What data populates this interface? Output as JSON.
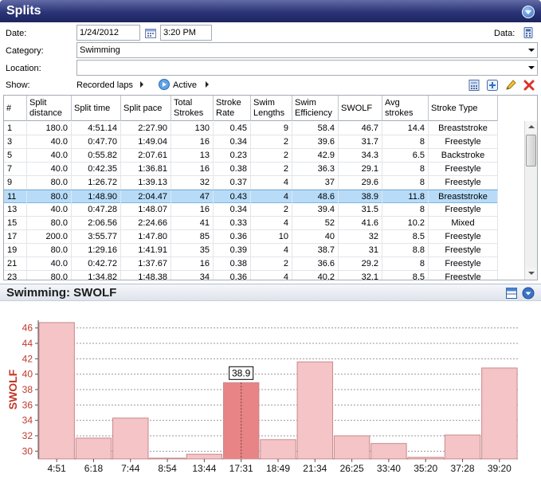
{
  "panel": {
    "title": "Splits"
  },
  "form": {
    "date_label": "Date:",
    "date_value": "1/24/2012",
    "time_value": "3:20 PM",
    "data_label": "Data:",
    "category_label": "Category:",
    "category_value": "Swimming",
    "location_label": "Location:",
    "location_value": "",
    "show_label": "Show:",
    "show_option_1": "Recorded laps",
    "show_option_2": "Active"
  },
  "table": {
    "columns": [
      "#",
      "Split distance",
      "Split time",
      "Split pace",
      "Total Strokes",
      "Stroke Rate",
      "Swim Lengths",
      "Swim Efficiency",
      "SWOLF",
      "Avg strokes",
      "Stroke Type"
    ],
    "rows": [
      [
        "1",
        "180.0",
        "4:51.14",
        "2:27.90",
        "130",
        "0.45",
        "9",
        "58.4",
        "46.7",
        "14.4",
        "Breaststroke"
      ],
      [
        "3",
        "40.0",
        "0:47.70",
        "1:49.04",
        "16",
        "0.34",
        "2",
        "39.6",
        "31.7",
        "8",
        "Freestyle"
      ],
      [
        "5",
        "40.0",
        "0:55.82",
        "2:07.61",
        "13",
        "0.23",
        "2",
        "42.9",
        "34.3",
        "6.5",
        "Backstroke"
      ],
      [
        "7",
        "40.0",
        "0:42.35",
        "1:36.81",
        "16",
        "0.38",
        "2",
        "36.3",
        "29.1",
        "8",
        "Freestyle"
      ],
      [
        "9",
        "80.0",
        "1:26.72",
        "1:39.13",
        "32",
        "0.37",
        "4",
        "37",
        "29.6",
        "8",
        "Freestyle"
      ],
      [
        "11",
        "80.0",
        "1:48.90",
        "2:04.47",
        "47",
        "0.43",
        "4",
        "48.6",
        "38.9",
        "11.8",
        "Breaststroke"
      ],
      [
        "13",
        "40.0",
        "0:47.28",
        "1:48.07",
        "16",
        "0.34",
        "2",
        "39.4",
        "31.5",
        "8",
        "Freestyle"
      ],
      [
        "15",
        "80.0",
        "2:06.56",
        "2:24.66",
        "41",
        "0.33",
        "4",
        "52",
        "41.6",
        "10.2",
        "Mixed"
      ],
      [
        "17",
        "200.0",
        "3:55.77",
        "1:47.80",
        "85",
        "0.36",
        "10",
        "40",
        "32",
        "8.5",
        "Freestyle"
      ],
      [
        "19",
        "80.0",
        "1:29.16",
        "1:41.91",
        "35",
        "0.39",
        "4",
        "38.7",
        "31",
        "8.8",
        "Freestyle"
      ],
      [
        "21",
        "40.0",
        "0:42.72",
        "1:37.67",
        "16",
        "0.38",
        "2",
        "36.6",
        "29.2",
        "8",
        "Freestyle"
      ],
      [
        "23",
        "80.0",
        "1:34.82",
        "1:48.38",
        "34",
        "0.36",
        "4",
        "40.2",
        "32.1",
        "8.5",
        "Freestyle"
      ]
    ],
    "selected_row": 5
  },
  "chart_header": {
    "title": "Swimming: SWOLF"
  },
  "chart_data": {
    "type": "bar",
    "categories": [
      "4:51",
      "6:18",
      "7:44",
      "8:54",
      "13:44",
      "17:31",
      "18:49",
      "21:34",
      "26:25",
      "33:40",
      "35:20",
      "37:28",
      "39:20"
    ],
    "values": [
      46.7,
      31.7,
      34.3,
      29.1,
      29.6,
      38.9,
      31.5,
      41.6,
      32,
      31,
      29.2,
      32.1,
      40.8
    ],
    "ylabel": "SWOLF",
    "ylim": [
      29,
      47
    ],
    "yticks": [
      30,
      32,
      34,
      36,
      38,
      40,
      42,
      44,
      46
    ],
    "highlight_index": 5,
    "highlight_label": "38.9",
    "bar_color": "#f4c4c6",
    "bar_edge": "#c9898c",
    "highlight_color": "#e88486",
    "grid": true
  }
}
